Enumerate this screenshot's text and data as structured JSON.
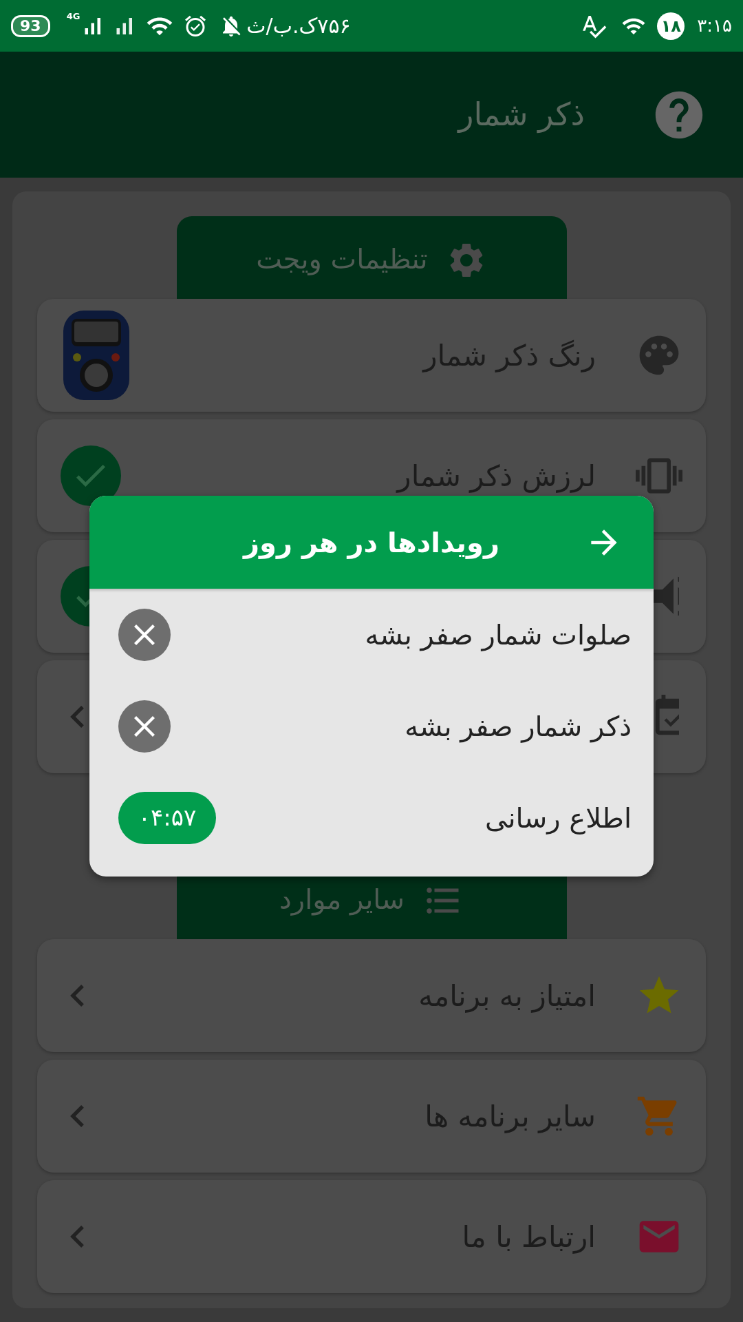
{
  "status_bar": {
    "battery": "93",
    "network": "4G",
    "speed": "۷۵۶ک.ب/ث",
    "notification_count": "۱۸",
    "time": "۳:۱۵"
  },
  "app_bar": {
    "title": "ذکر شمار"
  },
  "sections": [
    {
      "title": "تنظیمات ویجت",
      "rows": [
        {
          "label": "رنگ ذکر شمار",
          "kind": "image"
        },
        {
          "label": "لرزش ذکر شمار",
          "kind": "toggle",
          "checked": true
        },
        {
          "kind": "toggle",
          "checked": true
        },
        {
          "kind": "link"
        }
      ]
    },
    {
      "title": "سایر موارد",
      "rows": [
        {
          "label": "امتیاز به برنامه",
          "kind": "link"
        },
        {
          "label": "سایر برنامه ها",
          "kind": "link"
        },
        {
          "label": "ارتباط با ما",
          "kind": "link"
        }
      ]
    }
  ],
  "dialog": {
    "title": "رویدادها در هر روز",
    "items": [
      {
        "label": "صلوات شمار صفر بشه",
        "kind": "clear"
      },
      {
        "label": "ذکر شمار صفر بشه",
        "kind": "clear"
      },
      {
        "label": "اطلاع رسانی",
        "kind": "time",
        "value": "۰۴:۵۷"
      }
    ]
  }
}
